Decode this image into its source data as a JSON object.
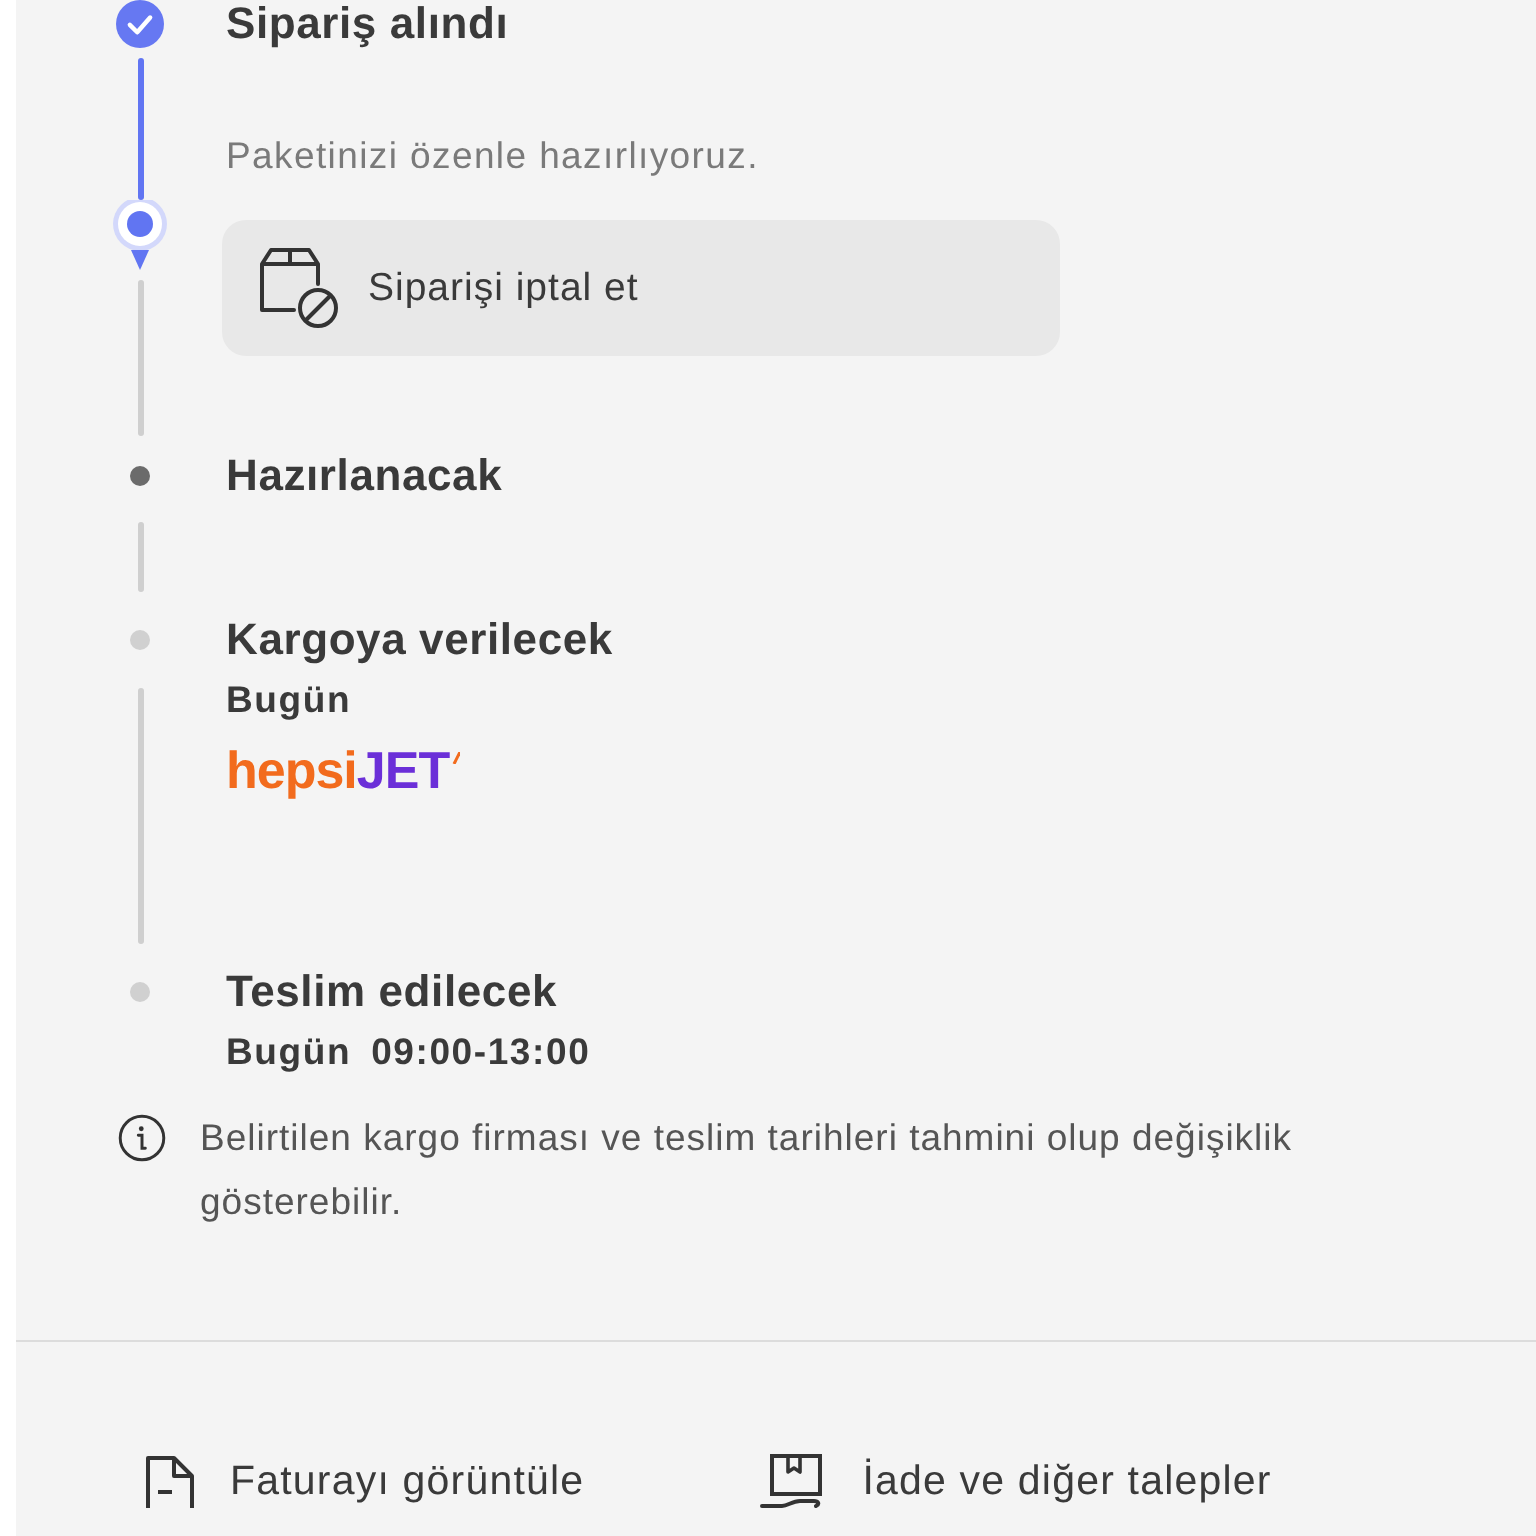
{
  "steps": [
    {
      "kind": "done",
      "title": "Sipariş alındı"
    },
    {
      "kind": "current",
      "note": "Paketinizi özenle hazırlıyoruz.",
      "action": "Siparişi iptal et"
    },
    {
      "kind": "next",
      "title": "Hazırlanacak"
    },
    {
      "kind": "upcoming",
      "title": "Kargoya verilecek",
      "date": "Bugün",
      "carrier_logo": [
        "hepsi",
        "JET"
      ]
    },
    {
      "kind": "upcoming",
      "title": "Teslim edilecek",
      "date": "Bugün",
      "time": "09:00-13:00"
    }
  ],
  "disclaimer": "Belirtilen kargo firması ve teslim tarihleri tahmini olup değişiklik gösterebilir.",
  "footer_actions": [
    {
      "kind": "invoice",
      "label": "Faturayı görüntüle"
    },
    {
      "kind": "return",
      "label": "İade ve diğer talepler"
    }
  ]
}
